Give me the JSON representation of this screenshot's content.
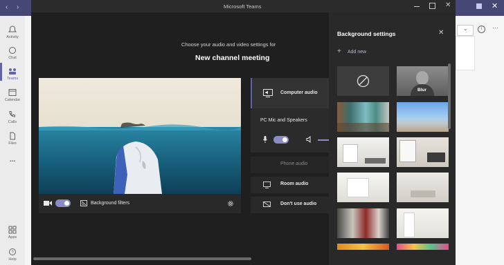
{
  "window": {
    "title": "Microsoft Teams"
  },
  "rail": {
    "items": [
      {
        "label": "Activity",
        "icon": "bell-icon"
      },
      {
        "label": "Chat",
        "icon": "chat-icon"
      },
      {
        "label": "Teams",
        "icon": "teams-icon",
        "active": true
      },
      {
        "label": "Calendar",
        "icon": "calendar-icon"
      },
      {
        "label": "Calls",
        "icon": "phone-icon"
      },
      {
        "label": "Files",
        "icon": "file-icon"
      },
      {
        "label": "...",
        "icon": "more-icon"
      },
      {
        "label": "Apps",
        "icon": "apps-icon"
      },
      {
        "label": "Help",
        "icon": "help-icon"
      }
    ]
  },
  "main": {
    "prompt": "Choose your audio and video settings for",
    "meeting_title": "New channel meeting"
  },
  "video_controls": {
    "camera_on": true,
    "background_filters_label": "Background filters"
  },
  "audio": {
    "computer_audio_label": "Computer audio",
    "device_label": "PC Mic and Speakers",
    "mic_on": true,
    "phone_audio_label": "Phone audio",
    "room_audio_label": "Room audio",
    "dont_use_audio_label": "Don't use audio"
  },
  "background_settings": {
    "title": "Background settings",
    "add_new_label": "Add new",
    "blur_label": "Blur"
  },
  "colors": {
    "accent": "#6264a7",
    "toggle": "#8b8cc7",
    "titlebar_bg": "#464775",
    "dialog_bg": "#1f1f1f"
  }
}
